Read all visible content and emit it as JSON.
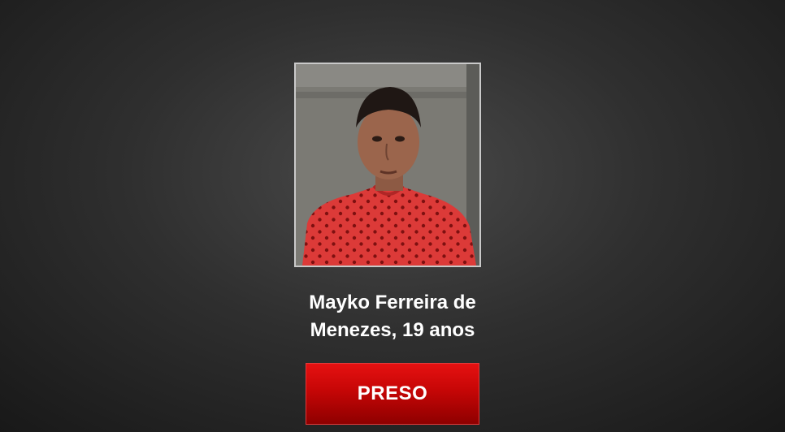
{
  "person": {
    "name_line1": "Mayko Ferreira de",
    "name_line2": "Menezes, 19 anos"
  },
  "status": {
    "label": "PRESO",
    "color": "#d40808"
  },
  "colors": {
    "background": "#2f2f2f",
    "photo_border": "#c9c9c9",
    "text": "#ffffff"
  }
}
